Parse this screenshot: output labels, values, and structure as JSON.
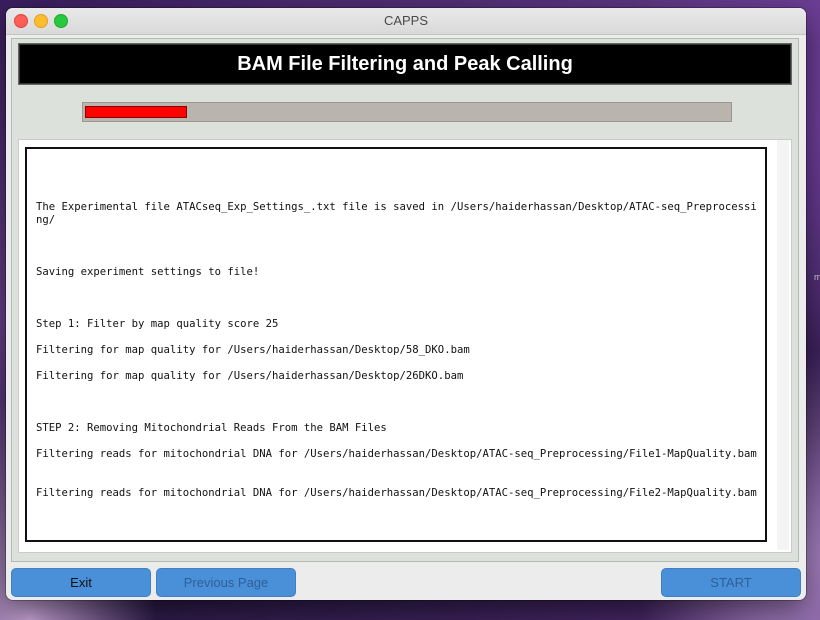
{
  "window": {
    "title": "CAPPS"
  },
  "header": {
    "title": "BAM File Filtering and Peak Calling"
  },
  "progress": {
    "fraction": 0.155,
    "fill_color": "#ff0000"
  },
  "log": {
    "lines": [
      "The Experimental file ATACseq_Exp_Settings_.txt file is saved in /Users/haiderhassan/Desktop/ATAC-seq_Preprocessing/",
      "Saving experiment settings to file!",
      "Step 1: Filter by map quality score 25",
      "Filtering for map quality for /Users/haiderhassan/Desktop/58_DKO.bam",
      "Filtering for map quality for /Users/haiderhassan/Desktop/26DKO.bam",
      "STEP 2: Removing Mitochondrial Reads From the BAM Files",
      "Filtering reads for mitochondrial DNA for /Users/haiderhassan/Desktop/ATAC-seq_Preprocessing/File1-MapQuality.bam",
      "Filtering reads for mitochondrial DNA for /Users/haiderhassan/Desktop/ATAC-seq_Preprocessing/File2-MapQuality.bam"
    ]
  },
  "buttons": {
    "exit": "Exit",
    "previous": "Previous Page",
    "start": "START"
  },
  "colors": {
    "button": "#4a90d9",
    "header_bg": "#000000",
    "header_text": "#ffffff"
  },
  "desktop": {
    "edge_glyph": "m"
  }
}
